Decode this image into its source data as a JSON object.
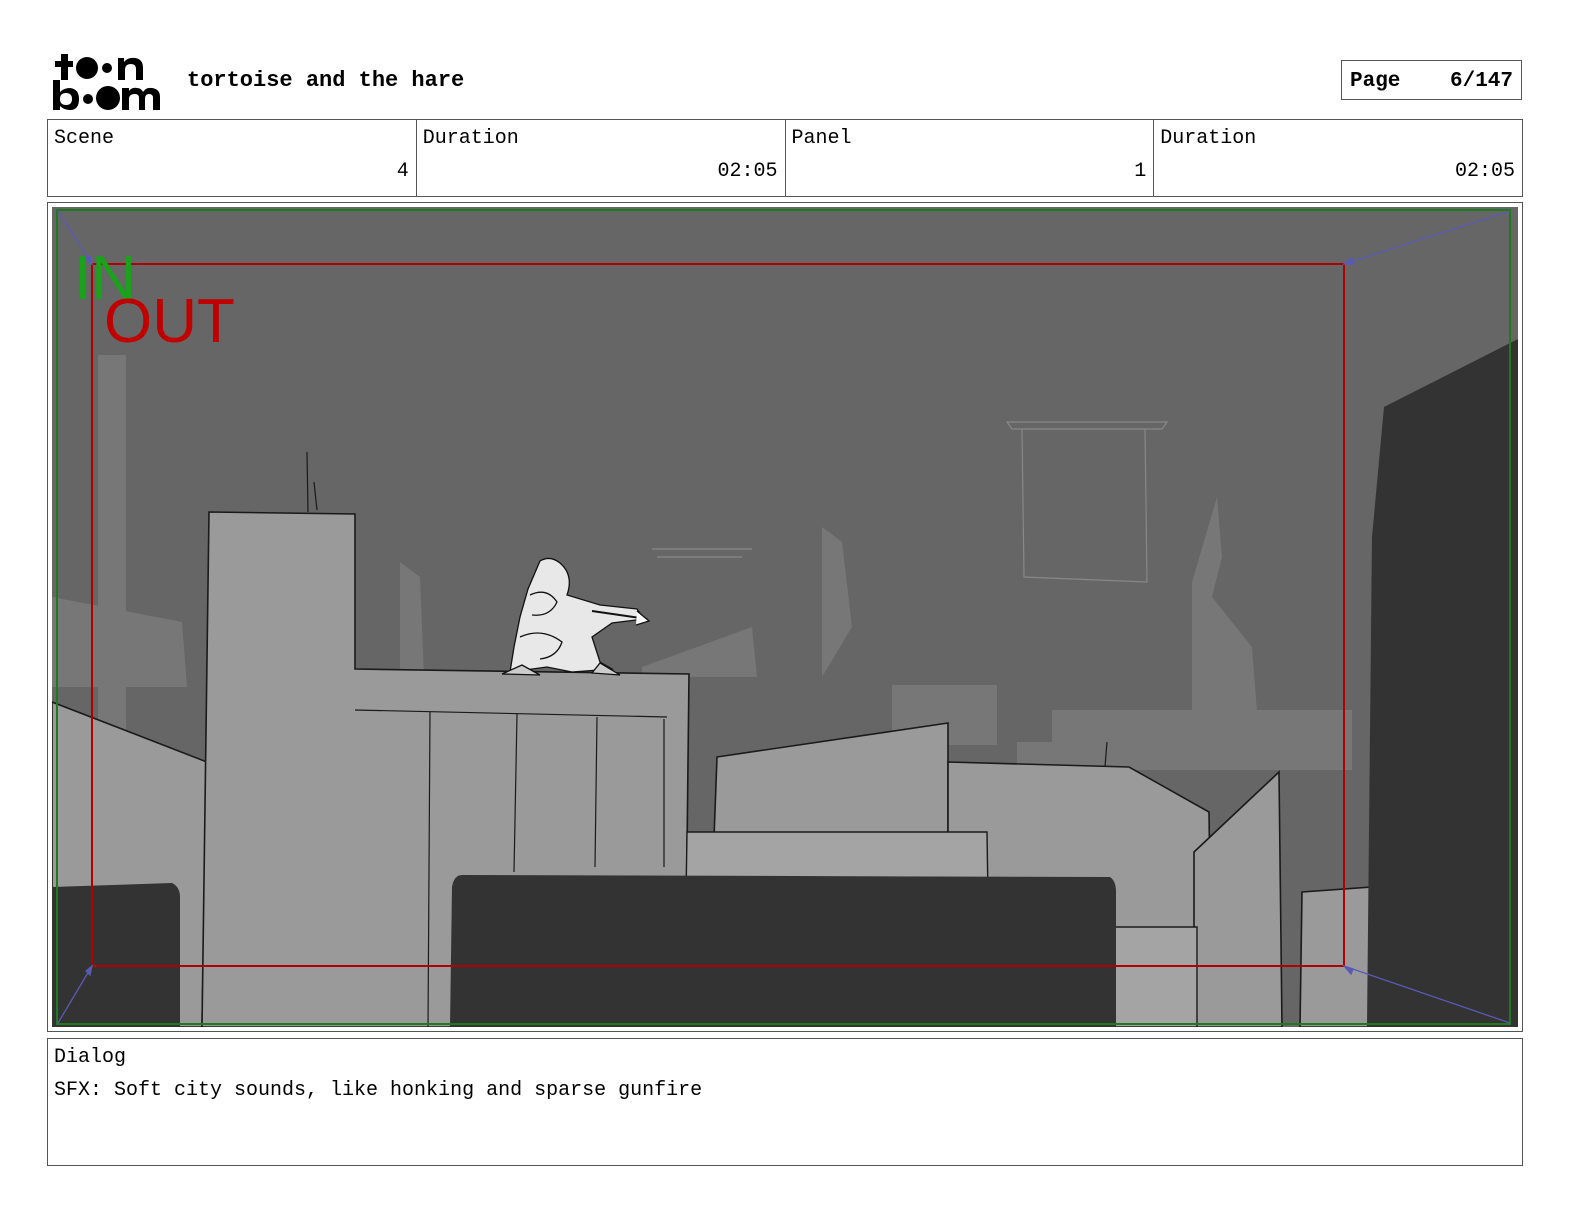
{
  "header": {
    "logo_text": "toon boom",
    "project_title": "tortoise and the hare",
    "page_label": "Page",
    "page_value": "6/147"
  },
  "info": {
    "scene_label": "Scene",
    "scene_value": "4",
    "scene_duration_label": "Duration",
    "scene_duration_value": "02:05",
    "panel_label": "Panel",
    "panel_value": "1",
    "panel_duration_label": "Duration",
    "panel_duration_value": "02:05"
  },
  "frame": {
    "in_label": "IN",
    "out_label": "OUT",
    "in_color": "#1aa31a",
    "out_color": "#c00000"
  },
  "dialog": {
    "label": "Dialog",
    "text": "SFX: Soft city sounds, like honking and sparse gunfire"
  }
}
